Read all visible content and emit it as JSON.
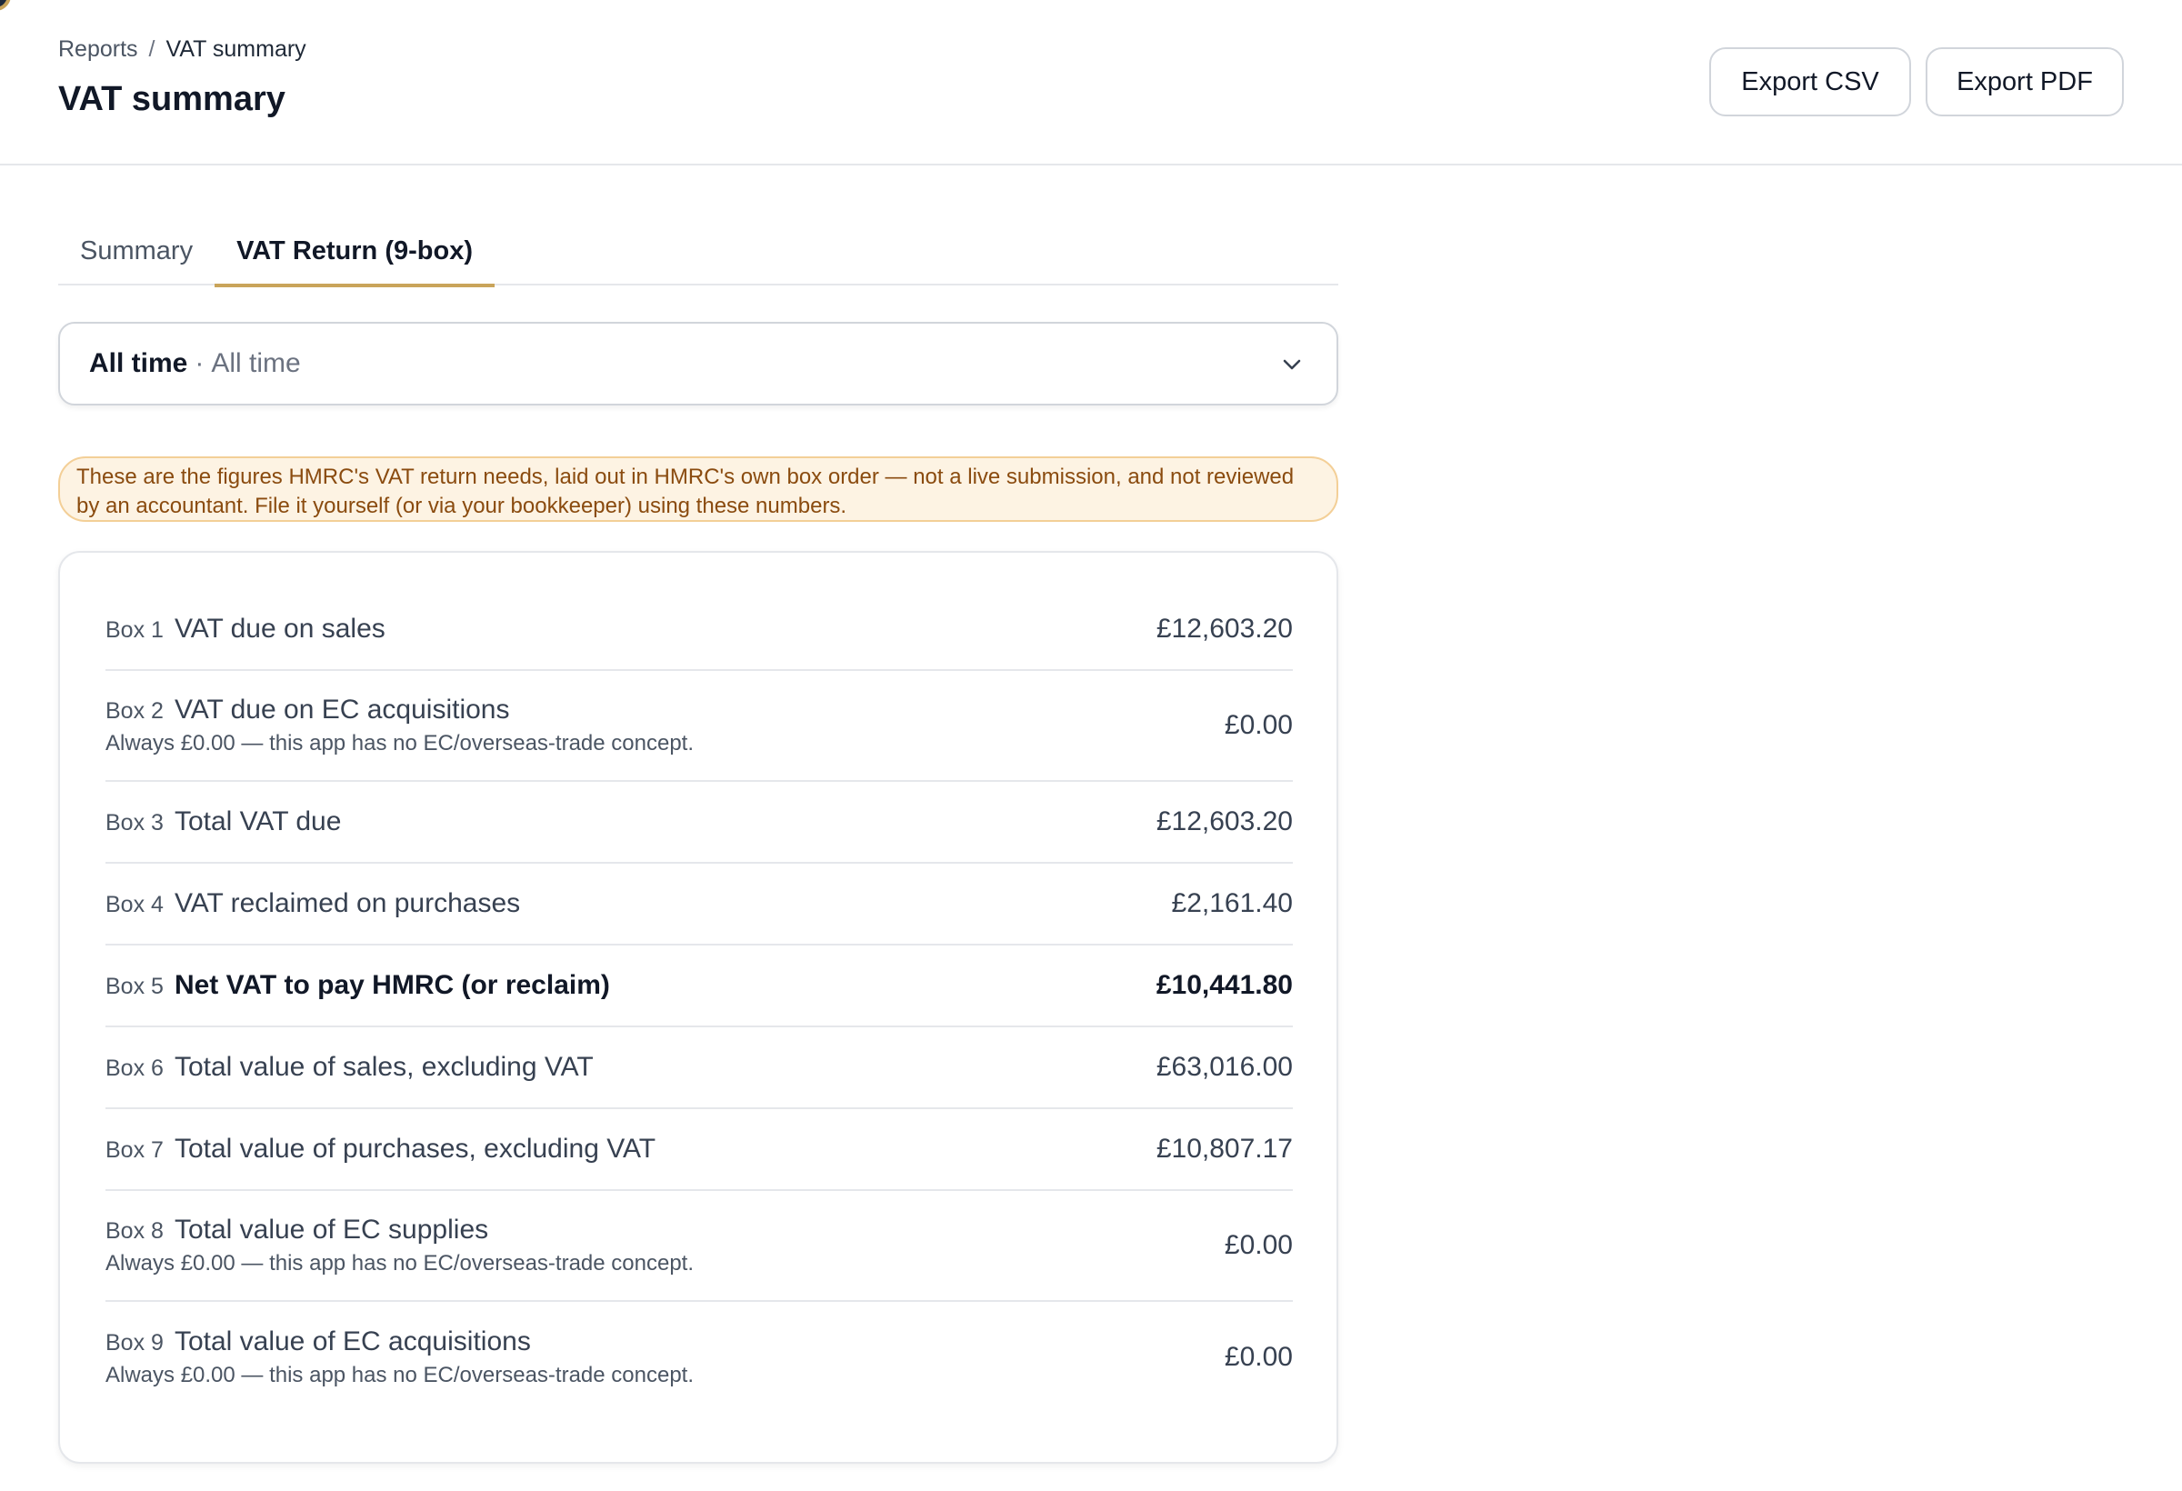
{
  "breadcrumb": {
    "parent": "Reports",
    "separator": "/",
    "current": "VAT summary"
  },
  "header": {
    "title": "VAT summary",
    "export_csv": "Export CSV",
    "export_pdf": "Export PDF"
  },
  "tabs": [
    {
      "label": "Summary",
      "active": false
    },
    {
      "label": "VAT Return (9-box)",
      "active": true
    }
  ],
  "period": {
    "primary": "All time",
    "separator": "·",
    "secondary": "All time"
  },
  "notice": "These are the figures HMRC's VAT return needs, laid out in HMRC's own box order — not a live submission, and not reviewed by an accountant. File it yourself (or via your bookkeeper) using these numbers.",
  "boxes": [
    {
      "code": "Box 1",
      "label": "VAT due on sales",
      "amount": "£12,603.20"
    },
    {
      "code": "Box 2",
      "label": "VAT due on EC acquisitions",
      "note": "Always £0.00 — this app has no EC/overseas-trade concept.",
      "amount": "£0.00"
    },
    {
      "code": "Box 3",
      "label": "Total VAT due",
      "amount": "£12,603.20"
    },
    {
      "code": "Box 4",
      "label": "VAT reclaimed on purchases",
      "amount": "£2,161.40"
    },
    {
      "code": "Box 5",
      "label": "Net VAT to pay HMRC (or reclaim)",
      "amount": "£10,441.80",
      "emphasis": true
    },
    {
      "code": "Box 6",
      "label": "Total value of sales, excluding VAT",
      "amount": "£63,016.00"
    },
    {
      "code": "Box 7",
      "label": "Total value of purchases, excluding VAT",
      "amount": "£10,807.17"
    },
    {
      "code": "Box 8",
      "label": "Total value of EC supplies",
      "note": "Always £0.00 — this app has no EC/overseas-trade concept.",
      "amount": "£0.00"
    },
    {
      "code": "Box 9",
      "label": "Total value of EC acquisitions",
      "note": "Always £0.00 — this app has no EC/overseas-trade concept.",
      "amount": "£0.00"
    }
  ],
  "colors": {
    "accent": "#c9a45a",
    "notice_bg": "#fdf3e3",
    "notice_text": "#8a4b0f",
    "notice_border": "#f3cf97"
  }
}
